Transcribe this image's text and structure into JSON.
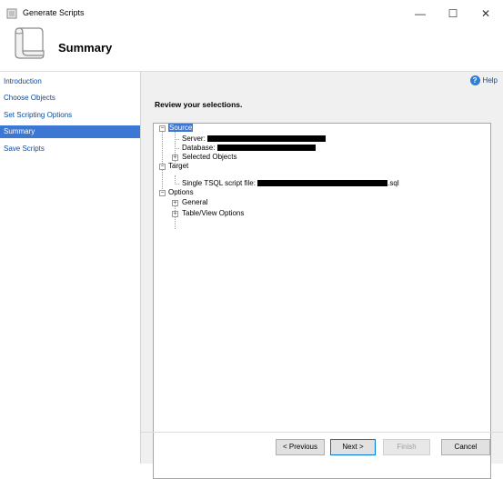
{
  "window": {
    "title": "Generate Scripts",
    "minimize_glyph": "—",
    "maximize_glyph": "☐",
    "close_glyph": "✕"
  },
  "header": {
    "title": "Summary"
  },
  "sidebar": {
    "items": [
      {
        "label": "Introduction",
        "active": false
      },
      {
        "label": "Choose Objects",
        "active": false
      },
      {
        "label": "Set Scripting Options",
        "active": false
      },
      {
        "label": "Summary",
        "active": true
      },
      {
        "label": "Save Scripts",
        "active": false
      }
    ]
  },
  "help": {
    "label": "Help"
  },
  "main": {
    "heading": "Review your selections."
  },
  "tree": {
    "source_label": "Source",
    "server_label": "Server:",
    "database_label": "Database:",
    "selected_objects_label": "Selected Objects",
    "target_label": "Target",
    "script_file_label": "Single TSQL script file:",
    "script_file_ext": ".sql",
    "options_label": "Options",
    "general_label": "General",
    "table_view_label": "Table/View Options"
  },
  "footer": {
    "previous_label": "< Previous",
    "next_label": "Next >",
    "finish_label": "Finish",
    "cancel_label": "Cancel"
  },
  "colors": {
    "selection": "#3c78d3",
    "link": "#0a4ea1",
    "content_bg": "#f0f0f0"
  }
}
